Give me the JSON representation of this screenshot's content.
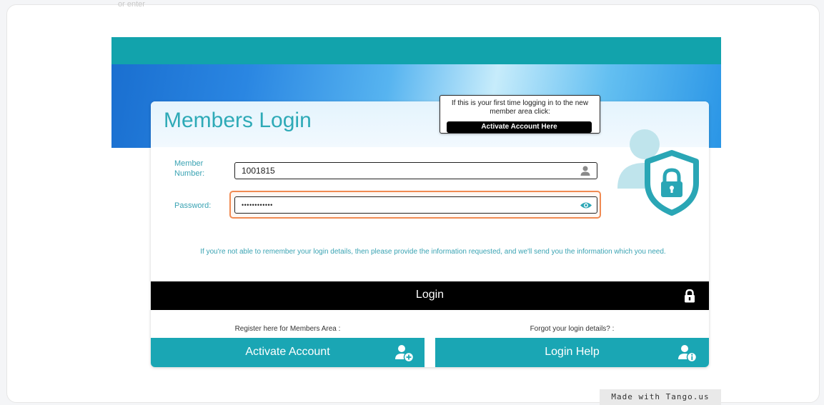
{
  "page": {
    "cropped_top_text": "or enter"
  },
  "login_card": {
    "title": "Members Login",
    "first_time_notice": {
      "text": "If this is your first time logging in to the new member area click:",
      "link_label": "Activate Account Here"
    },
    "member_number": {
      "label": "Member Number:",
      "value": "1001815",
      "icon": "person-icon"
    },
    "password": {
      "label": "Password:",
      "value": "••••••••••••",
      "icon": "eye-icon"
    },
    "help_text": "If you're not able to remember your login details, then please provide the information requested, and we'll send you the information which you need.",
    "login_button": {
      "label": "Login",
      "icon": "lock-icon"
    },
    "register": {
      "caption": "Register here for Members Area :",
      "button_label": "Activate Account",
      "icon": "add-user-icon"
    },
    "forgot": {
      "caption": "Forgot your login details? :",
      "button_label": "Login Help",
      "icon": "user-info-icon"
    }
  },
  "footer": {
    "watermark": "Made with Tango.us"
  },
  "colors": {
    "teal": "#12a3ac",
    "teal_button": "#1aa6b4",
    "label_teal": "#3aa3b3",
    "highlight_orange": "#f08a52"
  }
}
